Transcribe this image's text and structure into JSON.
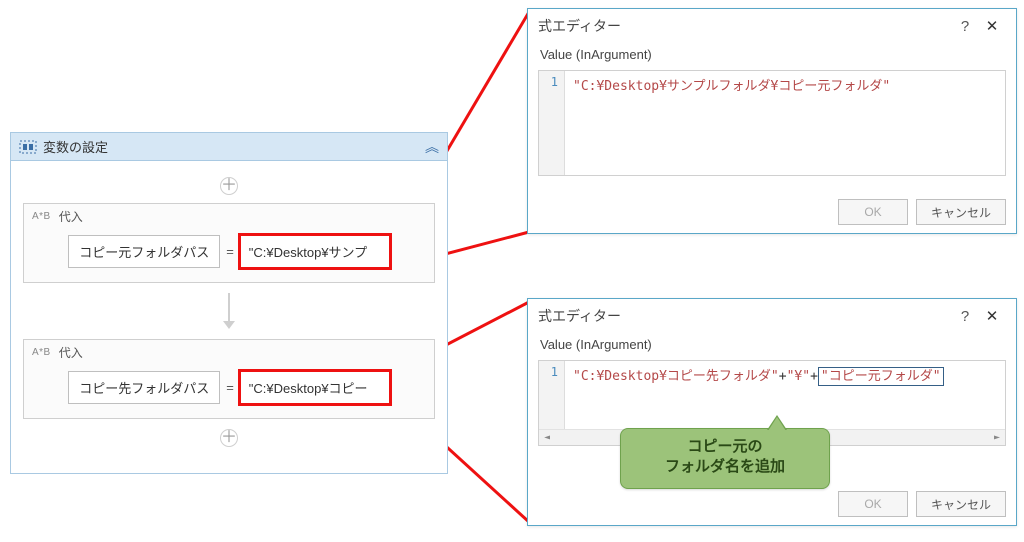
{
  "workflow": {
    "title": "変数の設定",
    "activities": [
      {
        "type_label": "A*B",
        "name": "代入",
        "variable": "コピー元フォルダパス",
        "value_preview": "\"C:¥Desktop¥サンプ"
      },
      {
        "type_label": "A*B",
        "name": "代入",
        "variable": "コピー先フォルダパス",
        "value_preview": "\"C:¥Desktop¥コピー"
      }
    ]
  },
  "editors": [
    {
      "title": "式エディター",
      "subtitle": "Value (InArgument)",
      "line_no": "1",
      "segments": [
        {
          "kind": "str",
          "text": "\"C:¥Desktop¥サンプルフォルダ¥コピー元フォルダ\""
        }
      ],
      "ok_label": "OK",
      "cancel_label": "キャンセル"
    },
    {
      "title": "式エディター",
      "subtitle": "Value (InArgument)",
      "line_no": "1",
      "segments": [
        {
          "kind": "str",
          "text": "\"C:¥Desktop¥コピー先フォルダ\""
        },
        {
          "kind": "op",
          "text": "+"
        },
        {
          "kind": "str",
          "text": "\"¥\""
        },
        {
          "kind": "op",
          "text": "+"
        },
        {
          "kind": "str-hi",
          "text": "\"コピー元フォルダ\""
        }
      ],
      "ok_label": "OK",
      "cancel_label": "キャンセル"
    }
  ],
  "callout": {
    "line1": "コピー元の",
    "line2": "フォルダ名を追加"
  },
  "glyphs": {
    "help": "?",
    "close": "✕",
    "chevron_up": "︽",
    "scroll_left": "◄",
    "scroll_right": "►"
  }
}
